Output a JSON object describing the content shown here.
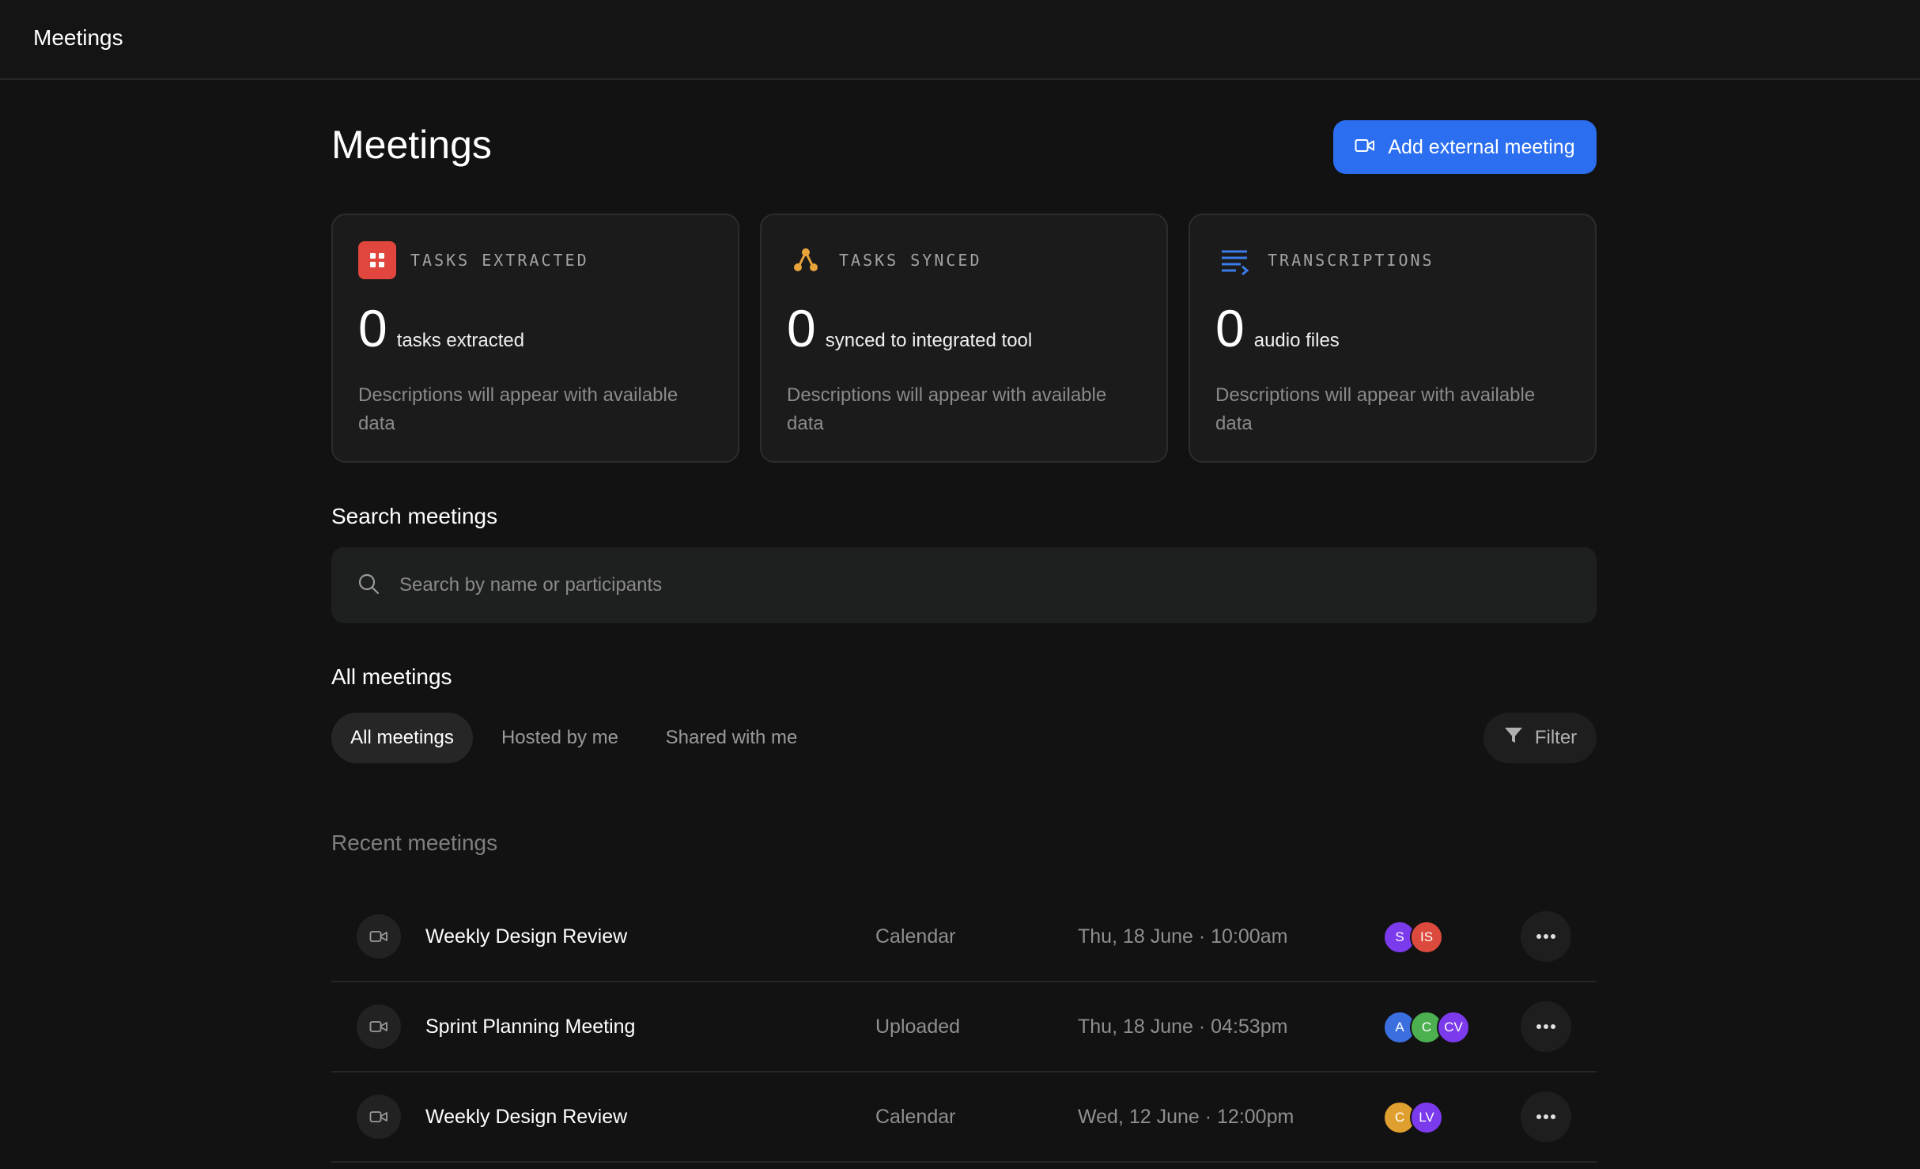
{
  "topbar": {
    "title": "Meetings"
  },
  "header": {
    "title": "Meetings",
    "add_button_label": "Add external meeting"
  },
  "stats": [
    {
      "label": "TASKS EXTRACTED",
      "value": "0",
      "unit": "tasks extracted",
      "description": "Descriptions will appear with available data",
      "icon": "grid-icon",
      "icon_color": "#e0463e"
    },
    {
      "label": "TASKS SYNCED",
      "value": "0",
      "unit": "synced to integrated tool",
      "description": "Descriptions will appear with available data",
      "icon": "nodes-icon",
      "icon_color": "#e8a43a"
    },
    {
      "label": "TRANSCRIPTIONS",
      "value": "0",
      "unit": "audio files",
      "description": "Descriptions will appear with available data",
      "icon": "text-lines-icon",
      "icon_color": "#3b7ce9"
    }
  ],
  "search": {
    "title": "Search meetings",
    "placeholder": "Search by name or participants",
    "value": ""
  },
  "all_meetings": {
    "title": "All meetings",
    "tabs": [
      {
        "label": "All meetings",
        "active": true
      },
      {
        "label": "Hosted by me",
        "active": false
      },
      {
        "label": "Shared with me",
        "active": false
      }
    ],
    "filter_label": "Filter"
  },
  "recent": {
    "title": "Recent meetings",
    "meetings": [
      {
        "name": "Weekly Design Review",
        "source": "Calendar",
        "date": "Thu, 18 June · 10:00am",
        "participants": [
          {
            "initials": "S",
            "color": "#7c3aed"
          },
          {
            "initials": "IS",
            "color": "#dc4a3d"
          }
        ]
      },
      {
        "name": "Sprint Planning Meeting",
        "source": "Uploaded",
        "date": "Thu, 18 June · 04:53pm",
        "participants": [
          {
            "initials": "A",
            "color": "#3b6fe0"
          },
          {
            "initials": "C",
            "color": "#4caf50"
          },
          {
            "initials": "CV",
            "color": "#7c3aed"
          }
        ]
      },
      {
        "name": "Weekly Design Review",
        "source": "Calendar",
        "date": "Wed, 12 June · 12:00pm",
        "participants": [
          {
            "initials": "C",
            "color": "#e0a030"
          },
          {
            "initials": "LV",
            "color": "#7c3aed"
          }
        ]
      }
    ]
  }
}
